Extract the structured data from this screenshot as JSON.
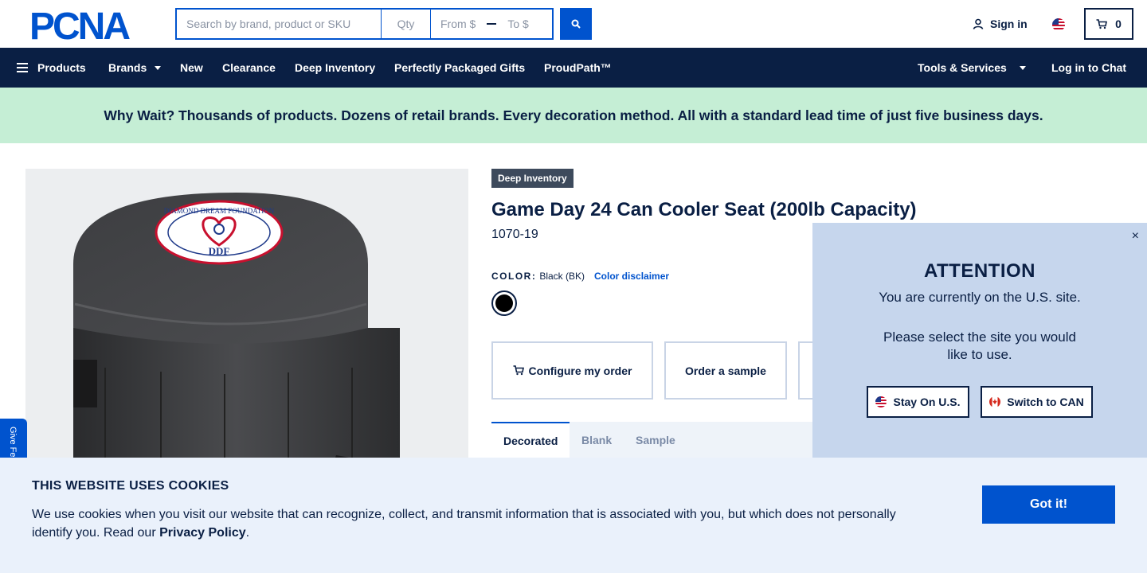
{
  "header": {
    "logo_text": "PCNA",
    "search_placeholder": "Search by brand, product or SKU",
    "qty_placeholder": "Qty",
    "from_placeholder": "From $",
    "to_placeholder": "To $",
    "signin_label": "Sign in",
    "cart_count": "0"
  },
  "nav": {
    "products": "Products",
    "brands": "Brands",
    "new": "New",
    "clearance": "Clearance",
    "deep_inventory": "Deep Inventory",
    "gifts": "Perfectly Packaged Gifts",
    "proudpath": "ProudPath™",
    "tools": "Tools & Services",
    "chat": "Log in to Chat"
  },
  "banner": {
    "text": "Why Wait? Thousands of products. Dozens of retail brands. Every decoration method. All with a standard lead time of just five business days."
  },
  "product": {
    "badge": "Deep Inventory",
    "title": "Game Day 24 Can Cooler Seat (200lb Capacity)",
    "sku": "1070-19",
    "color_label": "COLOR:",
    "color_value": "Black (BK)",
    "color_disclaimer": "Color disclaimer",
    "configure_label": "Configure my order",
    "sample_label": "Order a sample",
    "tabs": [
      "Decorated",
      "Blank",
      "Sample"
    ],
    "imprint_text": "DIAMOND DREAM FOUNDATION",
    "imprint_abbr": "DDF"
  },
  "feedback": {
    "label": "Give Feedback"
  },
  "site_modal": {
    "close": "×",
    "heading": "ATTENTION",
    "message1": "You are currently on the U.S. site.",
    "message2": "Please select the site you would like to use.",
    "stay_label": "Stay On U.S.",
    "switch_label": "Switch to CAN"
  },
  "cookie": {
    "heading": "THIS WEBSITE USES COOKIES",
    "text": "We use cookies when you visit our website that can recognize, collect, and transmit information that is associated with you, but which does not personally identify you. Read our",
    "link": "Privacy Policy",
    "end": ".",
    "button": "Got it!"
  },
  "colors": {
    "navy": "#0a1f44",
    "brand_blue": "#0053ce",
    "banner_green": "#c5eed5",
    "modal_blue": "#c6d6ed",
    "cookie_bg": "#eaf1fb"
  }
}
